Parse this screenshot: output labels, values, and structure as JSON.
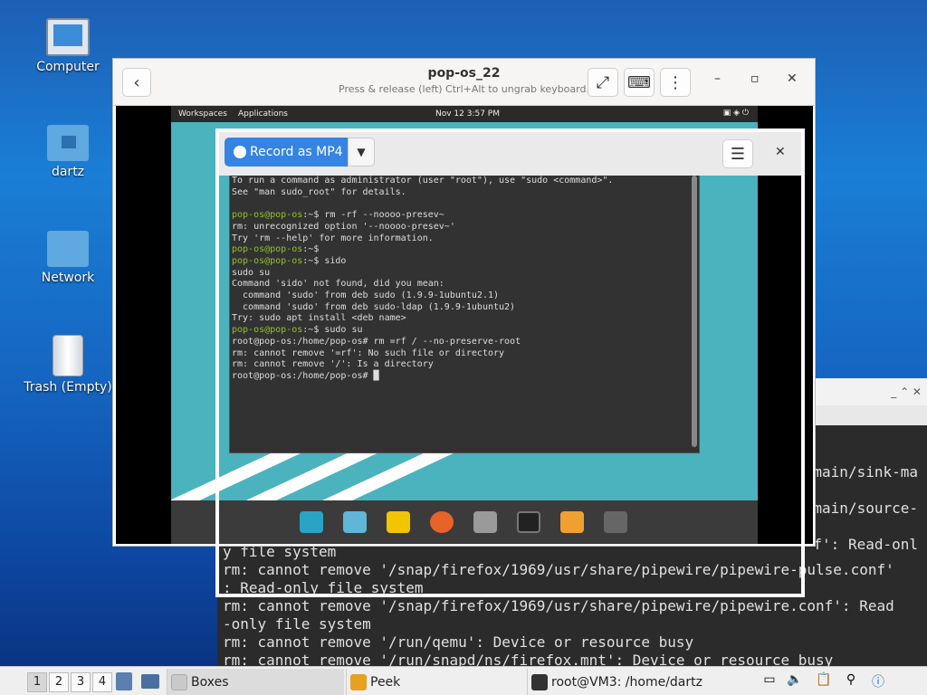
{
  "desktop": {
    "icons": [
      {
        "label": "Computer"
      },
      {
        "label": "dartz"
      },
      {
        "label": "Network"
      },
      {
        "label": "Trash (Empty)"
      }
    ]
  },
  "host_terminal": {
    "title_controls": "_ ⌃ ✕",
    "right_fragments": [
      "main/sink-ma",
      "main/source-",
      "f': Read-onl"
    ],
    "lines": [
      "y file system",
      "rm: cannot remove '/snap/firefox/1969/usr/share/pipewire/pipewire-pulse.conf'",
      ": Read-only file system",
      "rm: cannot remove '/snap/firefox/1969/usr/share/pipewire/pipewire.conf': Read",
      "-only file system",
      "rm: cannot remove '/run/qemu': Device or resource busy",
      "rm: cannot remove '/run/snapd/ns/firefox.mnt': Device or resource busy"
    ]
  },
  "boxes_window": {
    "title": "pop-os_22",
    "subtitle": "Press & release (left) Ctrl+Alt to ungrab keyboard."
  },
  "guest": {
    "topbar": {
      "workspaces": "Workspaces",
      "applications": "Applications",
      "clock": "Nov 12  3:57 PM"
    },
    "terminal_lines": [
      {
        "prompt": "",
        "text": "To run a command as administrator (user \"root\"), use \"sudo <command>\"."
      },
      {
        "prompt": "",
        "text": "See \"man sudo_root\" for details."
      },
      {
        "prompt": "",
        "text": ""
      },
      {
        "prompt": "pop-os@pop-os",
        "text": ":~$ rm -rf --noooo-presev~"
      },
      {
        "prompt": "",
        "text": "rm: unrecognized option '--noooo-presev~'"
      },
      {
        "prompt": "",
        "text": "Try 'rm --help' for more information."
      },
      {
        "prompt": "pop-os@pop-os",
        "text": ":~$"
      },
      {
        "prompt": "pop-os@pop-os",
        "text": ":~$ sido"
      },
      {
        "prompt": "",
        "text": "sudo su"
      },
      {
        "prompt": "",
        "text": "Command 'sido' not found, did you mean:"
      },
      {
        "prompt": "",
        "text": "  command 'sudo' from deb sudo (1.9.9-1ubuntu2.1)"
      },
      {
        "prompt": "",
        "text": "  command 'sudo' from deb sudo-ldap (1.9.9-1ubuntu2)"
      },
      {
        "prompt": "",
        "text": "Try: sudo apt install <deb name>"
      },
      {
        "prompt": "pop-os@pop-os",
        "text": ":~$ sudo su"
      },
      {
        "prompt": "",
        "text": "root@pop-os:/home/pop-os# rm =rf / --no-preserve-root"
      },
      {
        "prompt": "",
        "text": "rm: cannot remove '=rf': No such file or directory"
      },
      {
        "prompt": "",
        "text": "rm: cannot remove '/': Is a directory"
      },
      {
        "prompt": "",
        "text": "root@pop-os:/home/pop-os# █"
      }
    ]
  },
  "peek": {
    "record_label": "Record as MP4"
  },
  "taskbar": {
    "workspaces": [
      "1",
      "2",
      "3",
      "4"
    ],
    "tasks": [
      {
        "label": "Boxes",
        "color": "#c9c9c9"
      },
      {
        "label": "Peek",
        "color": "#e8a020"
      },
      {
        "label": "root@VM3: /home/dartz",
        "color": "#333333"
      }
    ]
  }
}
